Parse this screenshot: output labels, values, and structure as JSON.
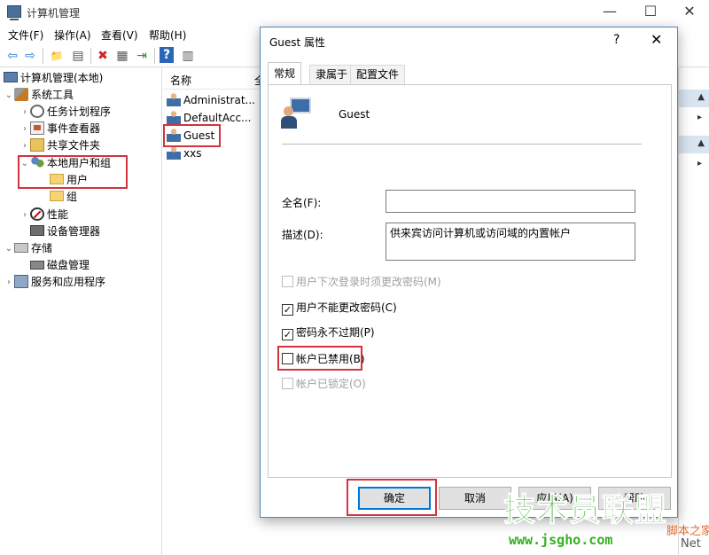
{
  "window": {
    "title": "计算机管理",
    "controls": {
      "minimize": "—",
      "maximize": "☐",
      "close": "✕"
    }
  },
  "menu": {
    "file": "文件(F)",
    "action": "操作(A)",
    "view": "查看(V)",
    "help": "帮助(H)"
  },
  "toolbar": {
    "back": "⇦",
    "forward": "⇨",
    "up": "📁",
    "showhide": "▤",
    "delete": "✖",
    "properties": "▦",
    "export": "⇥",
    "help": "?",
    "show_pane": "▥"
  },
  "tree": {
    "root": "计算机管理(本地)",
    "system_tools": "系统工具",
    "task_scheduler": "任务计划程序",
    "event_viewer": "事件查看器",
    "shared_folders": "共享文件夹",
    "local_users_groups": "本地用户和组",
    "users": "用户",
    "groups": "组",
    "performance": "性能",
    "device_manager": "设备管理器",
    "storage": "存储",
    "disk_management": "磁盘管理",
    "services_apps": "服务和应用程序"
  },
  "list": {
    "header_name": "名称",
    "header_fullname": "全",
    "rows": [
      "Administrat...",
      "DefaultAcc...",
      "Guest",
      "xxs"
    ]
  },
  "dialog": {
    "title": "Guest 属性",
    "help": "?",
    "close": "✕",
    "tabs": [
      "常规",
      "隶属于",
      "配置文件"
    ],
    "username": "Guest",
    "fullname_label": "全名(F):",
    "fullname_value": "",
    "description_label": "描述(D):",
    "description_value": "供来宾访问计算机或访问域的内置帐户",
    "cb_must_change": "用户下次登录时须更改密码(M)",
    "cb_cannot_change": "用户不能更改密码(C)",
    "cb_never_expires": "密码永不过期(P)",
    "cb_disabled": "帐户已禁用(B)",
    "cb_locked": "帐户已锁定(O)",
    "checks": {
      "must_change": false,
      "cannot_change": true,
      "never_expires": true,
      "disabled": false,
      "locked": false
    },
    "btn_ok": "确定",
    "btn_cancel": "取消",
    "btn_apply": "应用(A)",
    "btn_help": "帮助"
  },
  "watermark": {
    "main": "技术员联盟",
    "url": "www.jsgho.com",
    "side": "脚本之家",
    "net": "Net"
  },
  "colors": {
    "highlight": "#d4323e",
    "accent": "#0078d7",
    "watermark": "#35b021"
  }
}
